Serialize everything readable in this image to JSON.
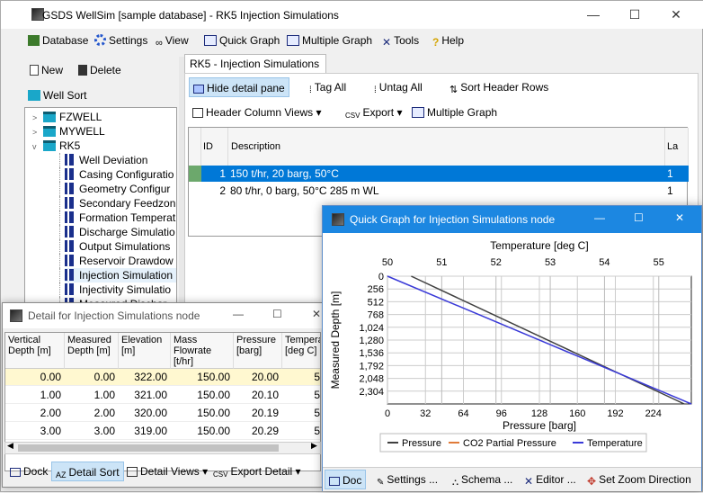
{
  "app": {
    "title": "GSDS WellSim [sample database] - RK5 Injection Simulations",
    "minimize": "—",
    "maximize": "☐",
    "close": "✕"
  },
  "menu": [
    "Database",
    "Settings",
    "View",
    "Quick Graph",
    "Multiple Graph",
    "Tools",
    "Help"
  ],
  "left": {
    "new": "New",
    "delete": "Delete",
    "well_sort": "Well Sort",
    "tree": [
      {
        "label": "FZWELL",
        "type": "well",
        "exp": ">"
      },
      {
        "label": "MYWELL",
        "type": "well",
        "exp": ">"
      },
      {
        "label": "RK5",
        "type": "well",
        "exp": "v"
      },
      {
        "label": "Well Deviation",
        "type": "item"
      },
      {
        "label": "Casing Configuratio",
        "type": "item"
      },
      {
        "label": "Geometry Configur",
        "type": "item"
      },
      {
        "label": "Secondary Feedzon",
        "type": "item"
      },
      {
        "label": "Formation Temperat",
        "type": "item"
      },
      {
        "label": "Discharge Simulatio",
        "type": "item"
      },
      {
        "label": "Output Simulations",
        "type": "item"
      },
      {
        "label": "Reservoir Drawdow",
        "type": "item"
      },
      {
        "label": "Injection Simulation",
        "type": "item",
        "selected": true
      },
      {
        "label": "Injectivity Simulatio",
        "type": "item"
      },
      {
        "label": "Measured Dischar",
        "type": "item"
      }
    ]
  },
  "tab": "RK5 - Injection Simulations",
  "toolbar1": {
    "hide": "Hide detail pane",
    "tag": "Tag All",
    "untag": "Untag All",
    "sort": "Sort Header Rows"
  },
  "toolbar2": {
    "hcv": "Header Column Views",
    "export": "Export",
    "mg": "Multiple Graph"
  },
  "grid": {
    "headers": [
      "ID",
      "Description",
      "La"
    ],
    "rows": [
      {
        "id": "1",
        "desc": "150 t/hr, 20 barg, 50°C",
        "la": "1"
      },
      {
        "id": "2",
        "desc": "80 t/hr, 0 barg, 50°C 285 m WL",
        "la": "1"
      }
    ]
  },
  "detail": {
    "title": "Detail for Injection Simulations node",
    "headers": [
      "Vertical Depth [m]",
      "Measured Depth [m]",
      "Elevation [m]",
      "Mass Flowrate [t/hr]",
      "Pressure [barg]",
      "Tempera [deg C]"
    ],
    "rows": [
      [
        "0.00",
        "0.00",
        "322.00",
        "150.00",
        "20.00",
        "5"
      ],
      [
        "1.00",
        "1.00",
        "321.00",
        "150.00",
        "20.10",
        "5"
      ],
      [
        "2.00",
        "2.00",
        "320.00",
        "150.00",
        "20.19",
        "5"
      ],
      [
        "3.00",
        "3.00",
        "319.00",
        "150.00",
        "20.29",
        "5"
      ]
    ],
    "bottom": {
      "dock": "Dock",
      "sort": "Detail Sort",
      "views": "Detail Views",
      "export": "Export Detail"
    }
  },
  "quickgraph": {
    "title": "Quick Graph for Injection Simulations node",
    "bottom": {
      "dock": "Doc",
      "settings": "Settings ...",
      "schema": "Schema ...",
      "editor": "Editor ...",
      "zoom": "Set Zoom Direction"
    }
  },
  "chart_data": {
    "type": "line",
    "title": "",
    "xlabel": "Pressure [barg]",
    "x2label": "Temperature [deg C]",
    "ylabel": "Measured Depth [m]",
    "xticks": [
      "0",
      "32",
      "64",
      "96",
      "128",
      "160",
      "192",
      "224"
    ],
    "x2ticks": [
      "50",
      "51",
      "52",
      "53",
      "54",
      "55"
    ],
    "yticks": [
      "0",
      "256",
      "512",
      "768",
      "1,024",
      "1,280",
      "1,536",
      "1,792",
      "2,048",
      "2,304"
    ],
    "xlim": [
      0,
      256
    ],
    "x2lim": [
      50,
      55.6
    ],
    "ylim": [
      0,
      2560
    ],
    "series": [
      {
        "name": "Pressure",
        "color": "#404040",
        "x": [
          20,
          250
        ],
        "y": [
          0,
          2560
        ]
      },
      {
        "name": "CO2 Partial Pressure",
        "color": "#e07b39",
        "x": [],
        "y": []
      },
      {
        "name": "Temperature",
        "color": "#3a3ad8",
        "x": [
          50,
          55.6
        ],
        "y": [
          0,
          2560
        ]
      }
    ],
    "legend": "bottom",
    "grid": true
  }
}
